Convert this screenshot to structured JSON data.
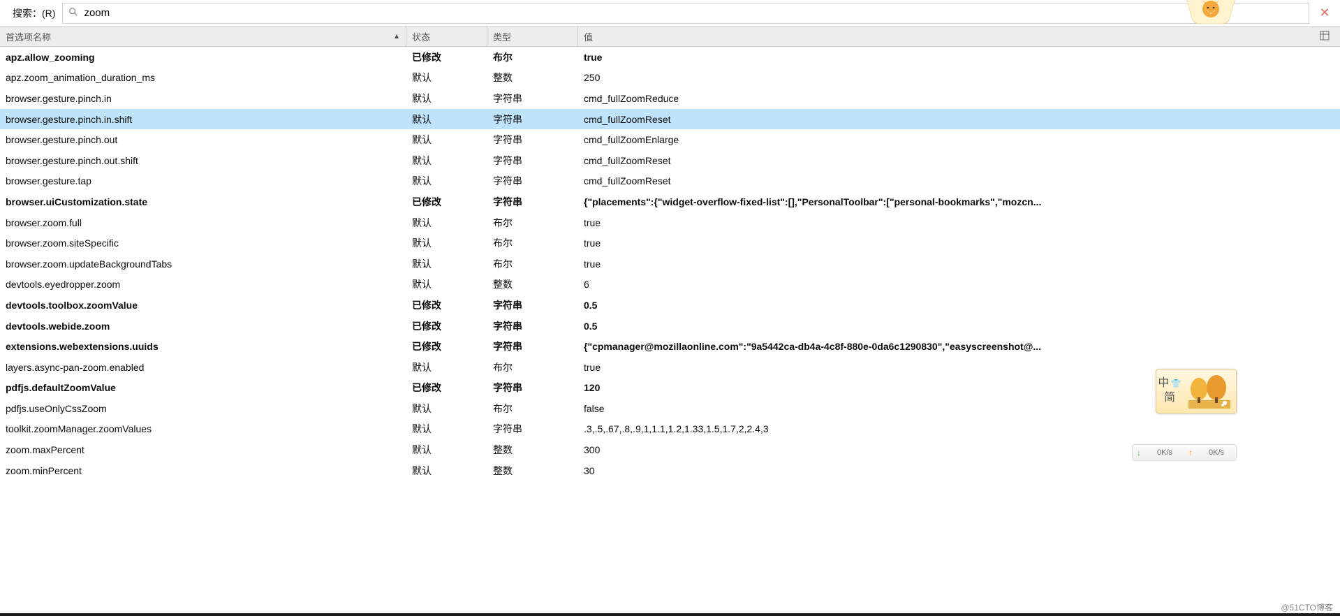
{
  "search": {
    "label": "搜索：(R)",
    "value": "zoom"
  },
  "header": {
    "name": "首选项名称",
    "status": "状态",
    "type": "类型",
    "value": "值"
  },
  "rows": [
    {
      "name": "apz.allow_zooming",
      "status": "已修改",
      "type": "布尔",
      "value": "true",
      "mod": true,
      "sel": false
    },
    {
      "name": "apz.zoom_animation_duration_ms",
      "status": "默认",
      "type": "整数",
      "value": "250",
      "mod": false,
      "sel": false
    },
    {
      "name": "browser.gesture.pinch.in",
      "status": "默认",
      "type": "字符串",
      "value": "cmd_fullZoomReduce",
      "mod": false,
      "sel": false
    },
    {
      "name": "browser.gesture.pinch.in.shift",
      "status": "默认",
      "type": "字符串",
      "value": "cmd_fullZoomReset",
      "mod": false,
      "sel": true
    },
    {
      "name": "browser.gesture.pinch.out",
      "status": "默认",
      "type": "字符串",
      "value": "cmd_fullZoomEnlarge",
      "mod": false,
      "sel": false
    },
    {
      "name": "browser.gesture.pinch.out.shift",
      "status": "默认",
      "type": "字符串",
      "value": "cmd_fullZoomReset",
      "mod": false,
      "sel": false
    },
    {
      "name": "browser.gesture.tap",
      "status": "默认",
      "type": "字符串",
      "value": "cmd_fullZoomReset",
      "mod": false,
      "sel": false
    },
    {
      "name": "browser.uiCustomization.state",
      "status": "已修改",
      "type": "字符串",
      "value": "{\"placements\":{\"widget-overflow-fixed-list\":[],\"PersonalToolbar\":[\"personal-bookmarks\",\"mozcn...",
      "mod": true,
      "sel": false
    },
    {
      "name": "browser.zoom.full",
      "status": "默认",
      "type": "布尔",
      "value": "true",
      "mod": false,
      "sel": false
    },
    {
      "name": "browser.zoom.siteSpecific",
      "status": "默认",
      "type": "布尔",
      "value": "true",
      "mod": false,
      "sel": false
    },
    {
      "name": "browser.zoom.updateBackgroundTabs",
      "status": "默认",
      "type": "布尔",
      "value": "true",
      "mod": false,
      "sel": false
    },
    {
      "name": "devtools.eyedropper.zoom",
      "status": "默认",
      "type": "整数",
      "value": "6",
      "mod": false,
      "sel": false
    },
    {
      "name": "devtools.toolbox.zoomValue",
      "status": "已修改",
      "type": "字符串",
      "value": "0.5",
      "mod": true,
      "sel": false
    },
    {
      "name": "devtools.webide.zoom",
      "status": "已修改",
      "type": "字符串",
      "value": "0.5",
      "mod": true,
      "sel": false
    },
    {
      "name": "extensions.webextensions.uuids",
      "status": "已修改",
      "type": "字符串",
      "value": "{\"cpmanager@mozillaonline.com\":\"9a5442ca-db4a-4c8f-880e-0da6c1290830\",\"easyscreenshot@...",
      "mod": true,
      "sel": false
    },
    {
      "name": "layers.async-pan-zoom.enabled",
      "status": "默认",
      "type": "布尔",
      "value": "true",
      "mod": false,
      "sel": false
    },
    {
      "name": "pdfjs.defaultZoomValue",
      "status": "已修改",
      "type": "字符串",
      "value": "120",
      "mod": true,
      "sel": false
    },
    {
      "name": "pdfjs.useOnlyCssZoom",
      "status": "默认",
      "type": "布尔",
      "value": "false",
      "mod": false,
      "sel": false
    },
    {
      "name": "toolkit.zoomManager.zoomValues",
      "status": "默认",
      "type": "字符串",
      "value": ".3,.5,.67,.8,.9,1,1.1,1.2,1.33,1.5,1.7,2,2.4,3",
      "mod": false,
      "sel": false
    },
    {
      "name": "zoom.maxPercent",
      "status": "默认",
      "type": "整数",
      "value": "300",
      "mod": false,
      "sel": false
    },
    {
      "name": "zoom.minPercent",
      "status": "默认",
      "type": "整数",
      "value": "30",
      "mod": false,
      "sel": false
    }
  ],
  "ime": {
    "line1": "中",
    "line2": "简"
  },
  "speed": {
    "down": "0K/s",
    "up": "0K/s"
  },
  "watermark": "@51CTO博客"
}
